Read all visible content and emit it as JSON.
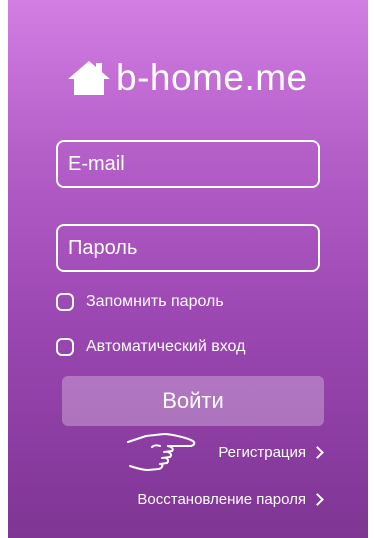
{
  "app": {
    "brand": "b-home.me",
    "logo_icon": "house-icon"
  },
  "form": {
    "email_placeholder": "E-mail",
    "password_placeholder": "Пароль",
    "remember_label": "Запомнить пароль",
    "auto_login_label": "Автоматический вход",
    "login_button": "Войти"
  },
  "links": {
    "register": "Регистрация",
    "recover_password": "Восстановление пароля"
  },
  "colors": {
    "gradient_top": "#d27ee2",
    "gradient_bottom": "#7e3593",
    "text": "#ffffff"
  },
  "icons": {
    "pointer": "pointing-hand-icon",
    "chevron": "chevron-right-icon"
  }
}
